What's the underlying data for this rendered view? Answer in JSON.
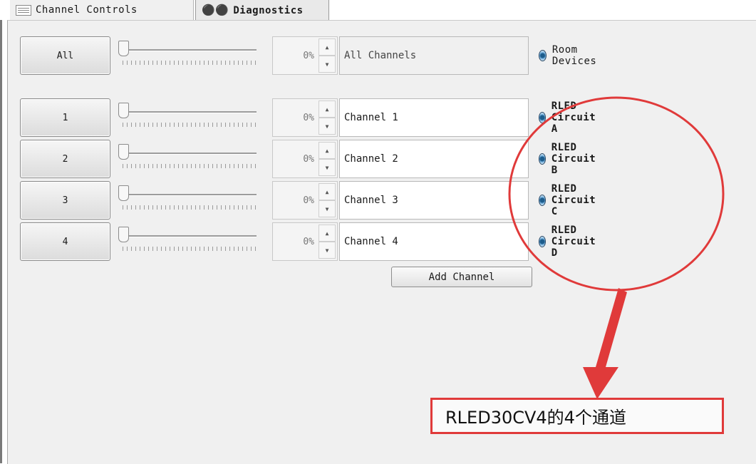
{
  "tabs": [
    {
      "label": "Channel Controls",
      "icon": "list-icon"
    },
    {
      "label": "Diagnostics",
      "icon": "binoculars-icon"
    }
  ],
  "master": {
    "button": "All",
    "level": "0%",
    "name": "All Channels",
    "group": "Room Devices"
  },
  "channels": [
    {
      "button": "1",
      "level": "0%",
      "name": "Channel 1",
      "circuit": "RLED Circuit A"
    },
    {
      "button": "2",
      "level": "0%",
      "name": "Channel 2",
      "circuit": "RLED Circuit B"
    },
    {
      "button": "3",
      "level": "0%",
      "name": "Channel 3",
      "circuit": "RLED Circuit C"
    },
    {
      "button": "4",
      "level": "0%",
      "name": "Channel 4",
      "circuit": "RLED Circuit D"
    }
  ],
  "add_channel_label": "Add Channel",
  "annotation": {
    "text": "RLED30CV4的4个通道",
    "color": "#e03a3a"
  }
}
